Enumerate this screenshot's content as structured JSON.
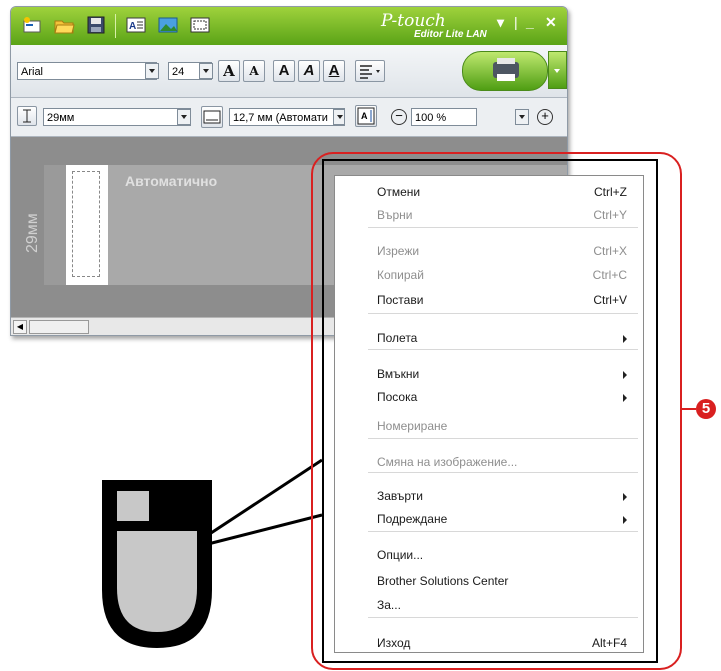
{
  "app": {
    "logo_text": "P-touch",
    "logo_sub": "Editor Lite LAN",
    "window_controls": [
      "▾",
      "|",
      "_",
      "✕"
    ]
  },
  "toolbar": {
    "font_name": "Arial",
    "font_size": "24",
    "grow_font_label": "A",
    "shrink_font_label": "A",
    "bold_label": "A",
    "italic_label": "A",
    "underline_label": "A"
  },
  "toolbar2": {
    "tape_width": "29мм",
    "label_length": "12,7 мм (Автомати",
    "zoom": "100 %"
  },
  "canvas": {
    "auto_text": "Автоматично",
    "size_text": "29мм"
  },
  "menu": {
    "items": [
      {
        "label": "Отмени",
        "shortcut": "Ctrl+Z",
        "enabled": true
      },
      {
        "label": "Върни",
        "shortcut": "Ctrl+Y",
        "enabled": false
      },
      {
        "label": "Изрежи",
        "shortcut": "Ctrl+X",
        "enabled": false
      },
      {
        "label": "Копирай",
        "shortcut": "Ctrl+C",
        "enabled": false
      },
      {
        "label": "Постави",
        "shortcut": "Ctrl+V",
        "enabled": true
      },
      {
        "label": "Полета",
        "shortcut": "",
        "enabled": true,
        "submenu": true
      },
      {
        "label": "Вмъкни",
        "shortcut": "",
        "enabled": true,
        "submenu": true
      },
      {
        "label": "Посока",
        "shortcut": "",
        "enabled": true,
        "submenu": true
      },
      {
        "label": "Номериране",
        "shortcut": "",
        "enabled": false
      },
      {
        "label": "Смяна на изображение...",
        "shortcut": "",
        "enabled": false
      },
      {
        "label": "Завърти",
        "shortcut": "",
        "enabled": true,
        "submenu": true
      },
      {
        "label": "Подреждане",
        "shortcut": "",
        "enabled": true,
        "submenu": true
      },
      {
        "label": "Опции...",
        "shortcut": "",
        "enabled": true
      },
      {
        "label": "Brother Solutions Center",
        "shortcut": "",
        "enabled": true
      },
      {
        "label": "За...",
        "shortcut": "",
        "enabled": true
      },
      {
        "label": "Изход",
        "shortcut": "Alt+F4",
        "enabled": true
      }
    ]
  },
  "callout": {
    "number": "5",
    "color": "#d92020"
  },
  "colors": {
    "titlebar": "#5aa317",
    "accent": "#9fd23c"
  }
}
